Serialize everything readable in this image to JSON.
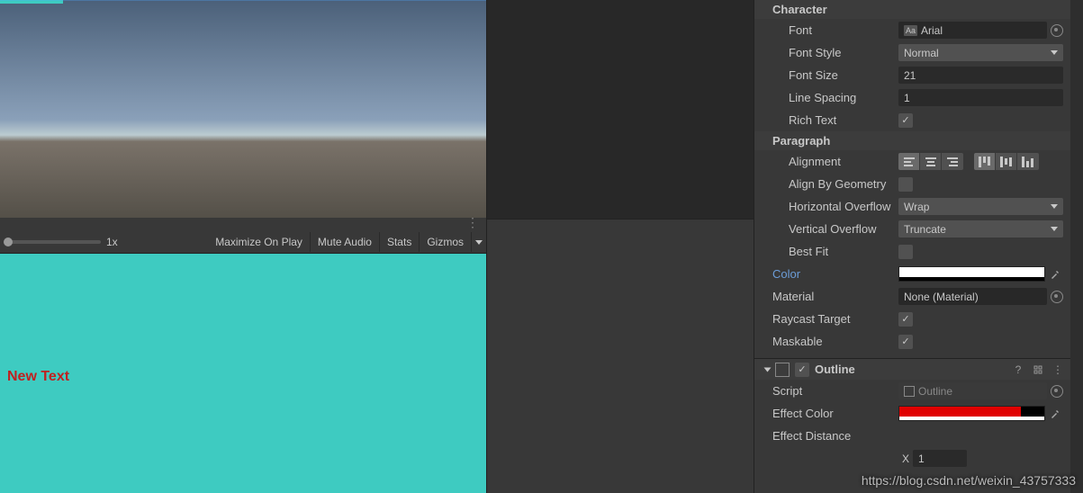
{
  "scene": {
    "handle_dots": "⋮"
  },
  "game_toolbar": {
    "scale_label": "1x",
    "maximize": "Maximize On Play",
    "mute": "Mute Audio",
    "stats": "Stats",
    "gizmos": "Gizmos"
  },
  "game_view": {
    "text": "New Text"
  },
  "inspector": {
    "character": {
      "header": "Character",
      "font_label": "Font",
      "font_value": "Arial",
      "font_style_label": "Font Style",
      "font_style_value": "Normal",
      "font_size_label": "Font Size",
      "font_size_value": "21",
      "line_spacing_label": "Line Spacing",
      "line_spacing_value": "1",
      "rich_text_label": "Rich Text",
      "rich_text_checked": "✓"
    },
    "paragraph": {
      "header": "Paragraph",
      "alignment_label": "Alignment",
      "align_geometry_label": "Align By Geometry",
      "h_overflow_label": "Horizontal Overflow",
      "h_overflow_value": "Wrap",
      "v_overflow_label": "Vertical Overflow",
      "v_overflow_value": "Truncate",
      "best_fit_label": "Best Fit"
    },
    "color_label": "Color",
    "material_label": "Material",
    "material_value": "None (Material)",
    "raycast_label": "Raycast Target",
    "raycast_checked": "✓",
    "maskable_label": "Maskable",
    "maskable_checked": "✓",
    "outline": {
      "title": "Outline",
      "enabled": "✓",
      "script_label": "Script",
      "script_value": "Outline",
      "effect_color_label": "Effect Color",
      "effect_distance_label": "Effect Distance",
      "x_label": "X",
      "x_value": "1"
    }
  },
  "watermark": "https://blog.csdn.net/weixin_43757333"
}
